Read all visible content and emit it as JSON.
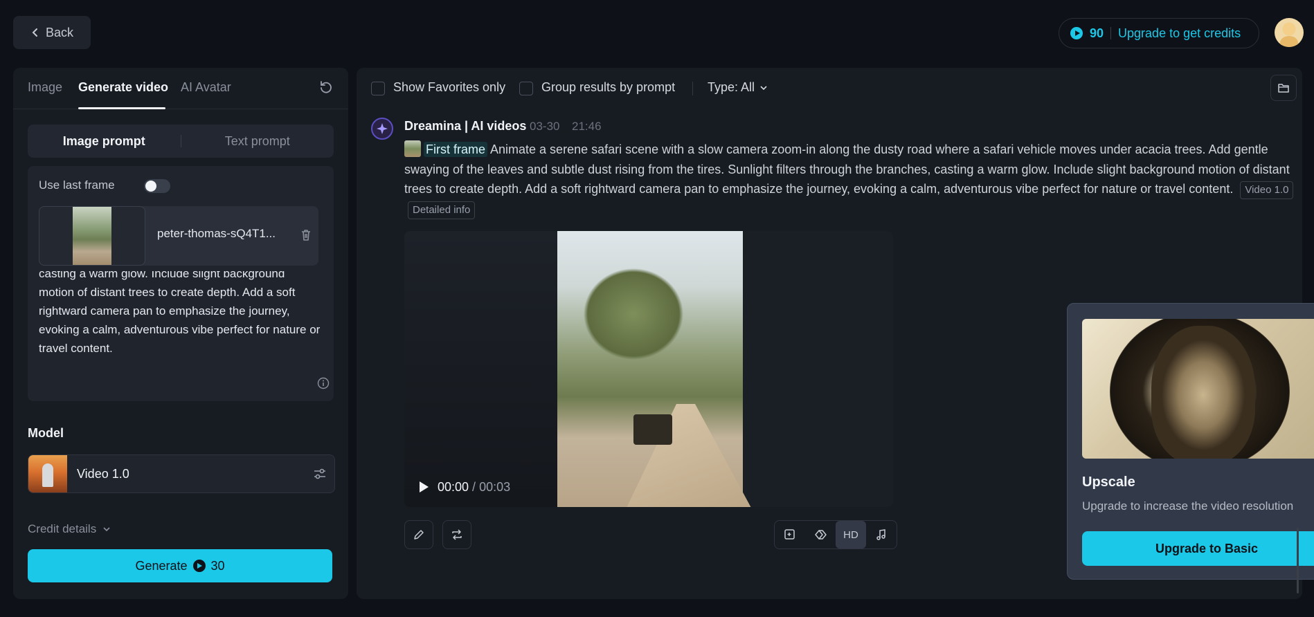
{
  "header": {
    "back_label": "Back",
    "credits": "90",
    "upgrade_label": "Upgrade to get credits"
  },
  "left": {
    "tabs": [
      {
        "label": "Image"
      },
      {
        "label": "Generate video"
      },
      {
        "label": "AI Avatar"
      }
    ],
    "prompt_modes": [
      "Image prompt",
      "Text prompt"
    ],
    "use_last_frame_label": "Use last frame",
    "use_last_frame_on": false,
    "file_name": "peter-thomas-sQ4T1...",
    "prompt_text": "casting a warm glow. Include slight background motion of distant trees to create depth. Add a soft rightward camera pan to emphasize the journey, evoking a calm, adventurous vibe perfect for nature or travel content.",
    "model_label": "Model",
    "model_name": "Video 1.0",
    "credit_details_label": "Credit details",
    "generate_label": "Generate",
    "generate_cost": "30"
  },
  "right": {
    "filters": {
      "favorites": "Show Favorites only",
      "group": "Group results by prompt",
      "type": "Type: All"
    },
    "entry": {
      "source": "Dreamina | AI videos",
      "date": "03-30",
      "time": "21:46",
      "first_frame_label": "First frame",
      "description": "Animate a serene safari scene with a slow camera zoom-in along the dusty road where a safari vehicle moves under acacia trees. Add gentle swaying of the leaves and subtle dust rising from the tires. Sunlight filters through the branches, casting a warm glow. Include slight background motion of distant trees to create depth. Add a soft rightward camera pan to emphasize the journey, evoking a calm, adventurous vibe perfect for nature or travel content.",
      "chips": [
        "Video 1.0",
        "Detailed info"
      ],
      "video": {
        "current_time": "00:00",
        "duration": "00:03"
      }
    },
    "popover": {
      "title": "Upscale",
      "subtitle": "Upgrade to increase the video resolution",
      "button_label": "Upgrade to Basic"
    },
    "toolbar": {
      "hd_label": "HD"
    }
  },
  "colors": {
    "accent": "#1cc8e8",
    "background": "#0e1117",
    "panel": "#171b22"
  }
}
